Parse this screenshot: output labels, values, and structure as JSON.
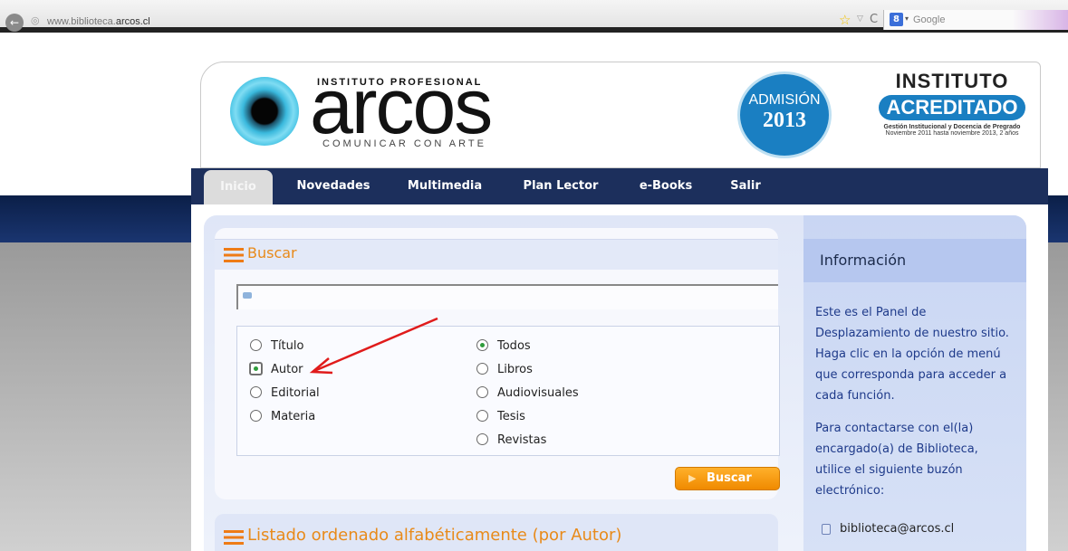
{
  "browser": {
    "url_prefix": "www.biblioteca.",
    "url_domain": "arcos.cl",
    "search_engine": "Google",
    "search_icon_letter": "8"
  },
  "header": {
    "logo_top": "INSTITUTO PROFESIONAL",
    "logo_word": "arcos",
    "logo_tagline": "COMUNICAR CON ARTE",
    "admission_title": "ADMISIÓN",
    "admission_year": "2013",
    "accredited_top": "INSTITUTO",
    "accredited_mid": "ACREDITADO",
    "accredited_line1": "Gestión Institucional y Docencia de Pregrado",
    "accredited_line2": "Noviembre 2011 hasta noviembre 2013, 2 años"
  },
  "nav": {
    "items": [
      {
        "label": "Inicio",
        "active": true
      },
      {
        "label": "Novedades"
      },
      {
        "label": "Multimedia"
      },
      {
        "label": "Plan Lector"
      },
      {
        "label": "e-Books"
      },
      {
        "label": "Salir"
      }
    ]
  },
  "search": {
    "title": "Buscar",
    "input_value": "",
    "field_options": [
      "Título",
      "Autor",
      "Editorial",
      "Materia"
    ],
    "field_selected": "Autor",
    "type_options": [
      "Todos",
      "Libros",
      "Audiovisuales",
      "Tesis",
      "Revistas"
    ],
    "type_selected": "Todos",
    "button_label": "Buscar"
  },
  "listing": {
    "title": "Listado ordenado alfabéticamente (por Autor)"
  },
  "info": {
    "title": "Información",
    "lines_1": [
      "Este es el Panel de",
      "Desplazamiento de nuestro sitio.",
      "Haga clic en la opción de menú",
      "que corresponda para acceder a",
      "cada función."
    ],
    "lines_2": [
      "Para contactarse con el(la)",
      "encargado(a) de Biblioteca,",
      "utilice el siguiente buzón",
      "electrónico:"
    ],
    "email": "biblioteca@arcos.cl"
  },
  "colors": {
    "accent_orange": "#ee7b16",
    "nav_blue": "#1c2f5c",
    "brand_blue": "#1a7fc2"
  }
}
